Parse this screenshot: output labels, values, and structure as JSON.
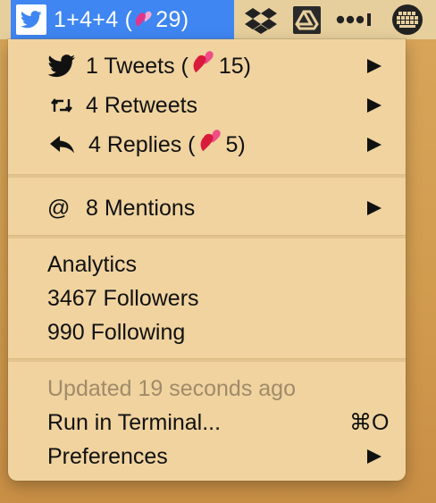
{
  "menubar": {
    "status_text_prefix": "1+4+4 (",
    "status_text_count": "29)",
    "icons": [
      "twitter-bird-icon",
      "heart-emoji-icon",
      "dropbox-icon",
      "google-drive-icon",
      "dots-icon",
      "grid-keyboard-icon"
    ]
  },
  "menu": {
    "tweets": {
      "prefix": "1 Tweets (",
      "count": "15)"
    },
    "retweets": {
      "label": "4 Retweets"
    },
    "replies": {
      "prefix": "4 Replies (",
      "count": "5)"
    },
    "mentions": {
      "label": "8 Mentions"
    },
    "analytics": {
      "heading": "Analytics",
      "followers": "3467 Followers",
      "following": "990 Following"
    },
    "updated": "Updated 19 seconds ago",
    "run_terminal": {
      "label": "Run in Terminal...",
      "shortcut": "⌘O"
    },
    "preferences": {
      "label": "Preferences"
    }
  },
  "colors": {
    "accent": "#3f86f2",
    "menu_bg": "#f0d39f",
    "heart": "#e0245e"
  }
}
